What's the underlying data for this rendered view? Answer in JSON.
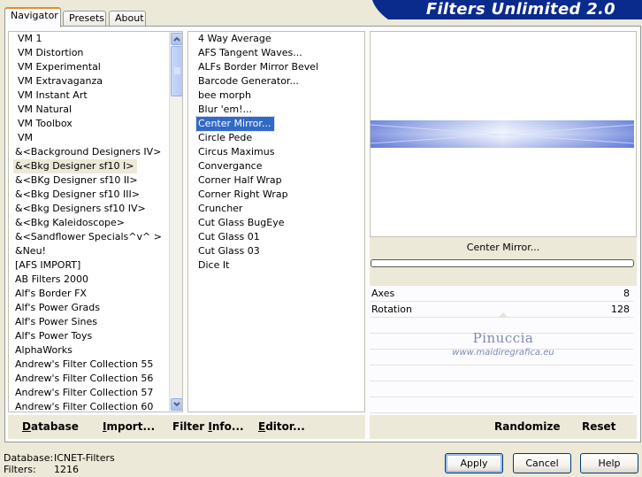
{
  "tabs": [
    "Navigator",
    "Presets",
    "About"
  ],
  "app_title": "Filters Unlimited 2.0",
  "categories": [
    "VM 1",
    "VM Distortion",
    "VM Experimental",
    "VM Extravaganza",
    "VM Instant Art",
    "VM Natural",
    "VM Toolbox",
    "VM",
    "&<Background Designers IV>",
    "&<Bkg Designer sf10 I>",
    "&<BKg Designer sf10 II>",
    "&<Bkg Designer sf10 III>",
    "&<Bkg Designers sf10 IV>",
    "&<Bkg Kaleidoscope>",
    "&<Sandflower Specials^v^ >",
    "&Neu!",
    "[AFS IMPORT]",
    "AB Filters 2000",
    "Alf's Border FX",
    "Alf's Power Grads",
    "Alf's Power Sines",
    "Alf's Power Toys",
    "AlphaWorks",
    "Andrew's Filter Collection 55",
    "Andrew's Filter Collection 56",
    "Andrew's Filter Collection 57",
    "Andrew's Filter Collection 60"
  ],
  "filters": [
    "4 Way Average",
    "AFS Tangent Waves...",
    "ALFs Border Mirror Bevel",
    "Barcode Generator...",
    "bee morph",
    "Blur 'em!...",
    "Center Mirror...",
    "Circle Pede",
    "Circus Maximus",
    "Convergance",
    "Corner Half Wrap",
    "Corner Right Wrap",
    "Cruncher",
    "Cut Glass  BugEye",
    "Cut Glass 01",
    "Cut Glass 03",
    "Dice It"
  ],
  "selected_category": "&<Bkg Designer sf10 I>",
  "selected_filter": "Center Mirror...",
  "left_buttons": {
    "database": {
      "u": "D",
      "rest": "atabase"
    },
    "import": {
      "u": "I",
      "rest": "mport..."
    },
    "filter_info": {
      "pre": "Filter ",
      "u": "I",
      "rest": "nfo..."
    },
    "editor": {
      "u": "E",
      "rest": "ditor..."
    }
  },
  "preview_filter_name": "Center Mirror...",
  "progress": 0,
  "params": [
    {
      "label": "Axes",
      "value": "8"
    },
    {
      "label": "Rotation",
      "value": "128"
    }
  ],
  "watermark": {
    "line1": "Pinuccia",
    "line2": "www.maidiregrafica.eu"
  },
  "right_buttons": {
    "randomize": "Randomize",
    "reset": "Reset"
  },
  "status": {
    "database_label": "Database:",
    "database_value": "ICNET-Filters",
    "filters_label": "Filters:",
    "filters_value": "1216"
  },
  "dialog_buttons": {
    "apply": "Apply",
    "cancel": "Cancel",
    "help": "Help"
  },
  "colors": {
    "title_banner": "#0a2a8c",
    "selection_blue": "#316ac5",
    "preview_strip": "#7f95e0",
    "watermark": "#7a8ab0"
  }
}
